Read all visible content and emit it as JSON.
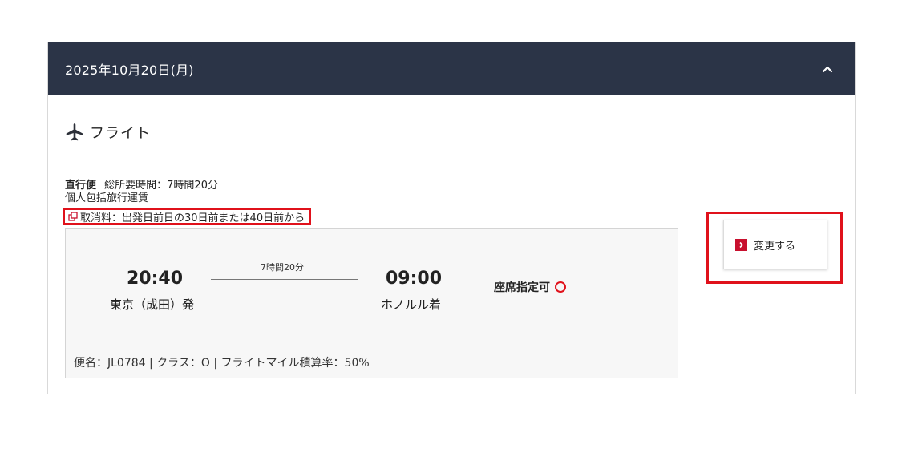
{
  "header": {
    "date": "2025年10月20日(月)",
    "collapse_icon": "chevron-up-icon"
  },
  "section": {
    "icon": "airplane-icon",
    "title": "フライト"
  },
  "info": {
    "direct_label": "直行便",
    "total_time": "総所要時間：7時間20分",
    "fare_type": "個人包括旅行運賃",
    "cancel_fee": "取消料：出発日前日の30日前または40日前から"
  },
  "flight": {
    "departure_time": "20:40",
    "departure_place": "東京（成田）発",
    "duration": "7時間20分",
    "arrival_time": "09:00",
    "arrival_place": "ホノルル着",
    "seat_label": "座席指定可",
    "meta": "便名：JL0784 |  クラス：O |  フライトマイル積算率：50%"
  },
  "actions": {
    "change_label": "変更する"
  },
  "colors": {
    "header_bg": "#2b3447",
    "accent_red": "#e0111b",
    "panel_bg": "#f7f7f7"
  }
}
